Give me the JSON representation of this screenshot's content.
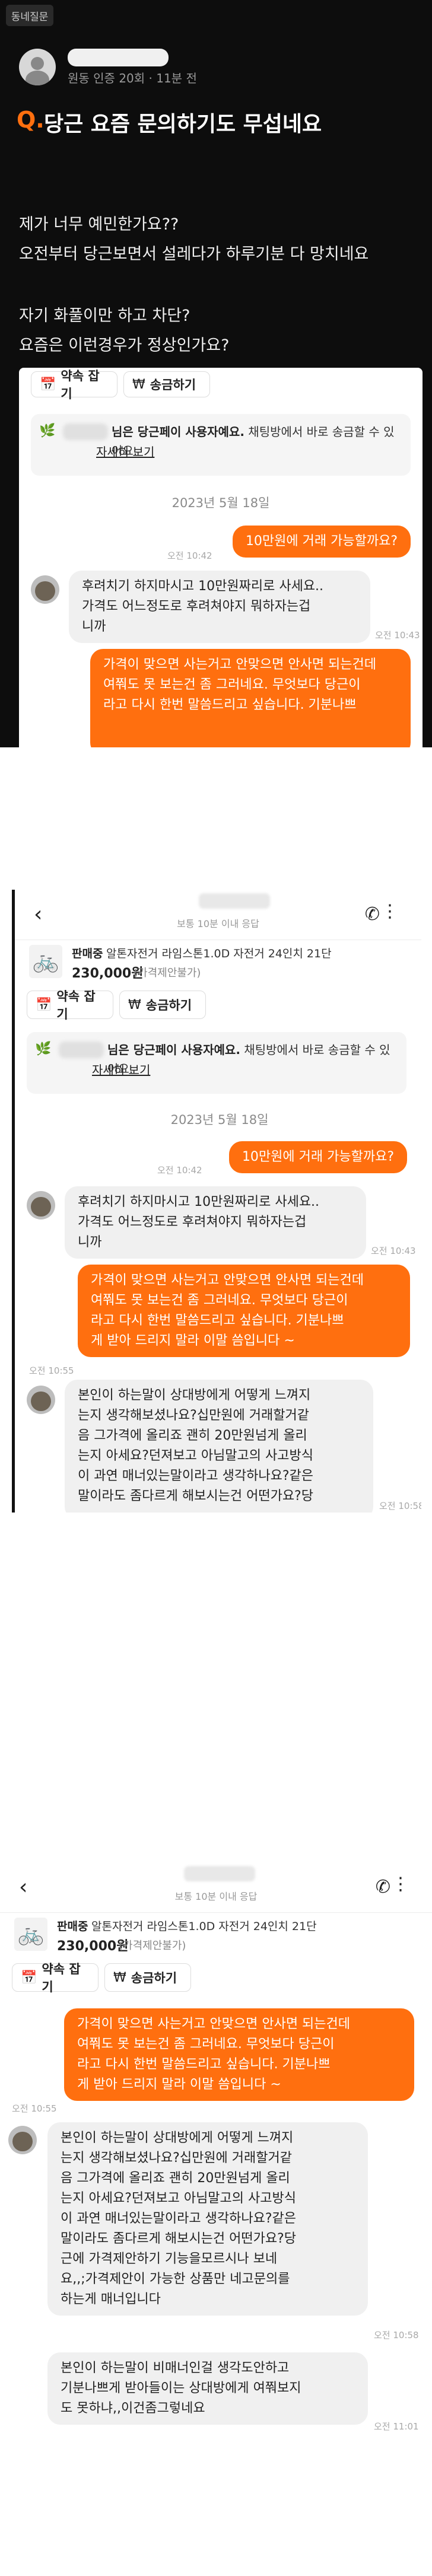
{
  "post": {
    "tag": "동네질문",
    "meta": "원동 인증 20회 · 11분 전",
    "q": "Q.",
    "title": "당근 요즘 문의하기도 무섭네요",
    "lines": [
      "제가 너무 예민한가요??",
      "오전부터 당근보면서 설레다가 하루기분 다 망치네요",
      "자기 화풀이만 하고 차단?",
      "요즘은 이런경우가 정상인가요?"
    ]
  },
  "chat": {
    "appointment_btn": "약속 잡기",
    "transfer_btn": "송금하기",
    "notice_bold": "님은 당근페이 사용자예요.",
    "notice_rest": "채팅방에서 바로 송금할 수 있어요.",
    "notice_link": "자세히 보기",
    "date": "2023년 5월 18일",
    "msg1": "10만원에 거래 가능할까요?",
    "time1": "오전 10:42",
    "reply1": [
      "후려치기 하지마시고 10만원짜리로 사세요..",
      "가격도 어느정도로 후려쳐야지 뭐하자는겁",
      "니까"
    ],
    "time2": "오전 10:43",
    "msg2": [
      "가격이 맞으면 사는거고 안맞으면 안사면 되는건데",
      "여쭤도 못 보는건 좀 그러네요.    무엇보다 당근이",
      "라고 다시 한번 말씀드리고 싶습니다.    기분나쁘",
      "게 받아 드리지  말라 이말 씀입니다 ~"
    ],
    "time3": "오전 10:55",
    "reply2": [
      "본인이 하는말이 상대방에게 어떻게 느껴지",
      "는지 생각해보셨나요?십만원에 거래할거같",
      "음 그가격에 올리죠 괜히 20만원넘게 올리",
      "는지 아세요?던져보고 아님말고의 사고방식",
      "이 과연 매너있는말이라고 생각하나요?같은",
      "말이라도 좀다르게 해보시는건 어떤가요?당",
      "근에 가격제안하기 기능을모르시나 보네",
      "요,,;가격제안이 가능한 상품만 네고문의를",
      "하는게 매너입니다"
    ],
    "time4": "오전 10:58",
    "reply3": [
      "본인이 하는말이 비매너인걸 생각도안하고",
      "기분나쁘게 받아들이는 상대방에게 여쭤보지",
      "도 못하냐,,이건좀그렇네요"
    ],
    "time5": "오전 11:01"
  },
  "header": {
    "subtitle": "보통 10분 이내 응답"
  },
  "product": {
    "status": "판매중",
    "title": "알톤자전거 라임스톤1.0D 자전거 24인치 21단",
    "price": "230,000원",
    "note": "(가격제안불가)"
  },
  "icons": {
    "calendar": "calendar-icon",
    "won": "won-icon",
    "back": "back-arrow-icon",
    "phone": "phone-icon",
    "more": "kebab-icon",
    "bike": "bicycle-icon"
  },
  "colors": {
    "accent": "#ff6f0f",
    "post_bg": "#0d0d0d",
    "bubble_gray": "#f0f0f0"
  }
}
